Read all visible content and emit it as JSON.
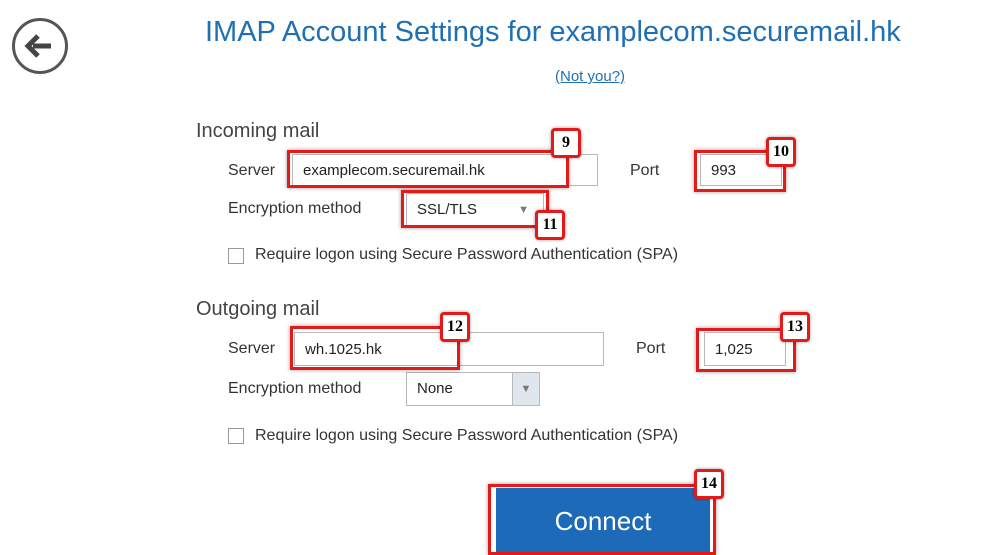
{
  "header": {
    "title": "IMAP Account Settings for examplecom.securemail.hk",
    "not_you": "(Not you?)"
  },
  "incoming": {
    "section_label": "Incoming mail",
    "server_label": "Server",
    "server_value": "examplecom.securemail.hk",
    "port_label": "Port",
    "port_value": "993",
    "encryption_label": "Encryption method",
    "encryption_value": "SSL/TLS",
    "spa_label": "Require logon using Secure Password Authentication (SPA)",
    "spa_checked": false
  },
  "outgoing": {
    "section_label": "Outgoing mail",
    "server_label": "Server",
    "server_value": "wh.1025.hk",
    "port_label": "Port",
    "port_value": "1,025",
    "encryption_label": "Encryption method",
    "encryption_value": "None",
    "spa_label": "Require logon using Secure Password Authentication (SPA)",
    "spa_checked": false
  },
  "connect_label": "Connect",
  "annotations": [
    "9",
    "10",
    "11",
    "12",
    "13",
    "14"
  ],
  "colors": {
    "accent": "#1f6fb4",
    "button": "#1d6ab8",
    "highlight": "#e21a1a"
  },
  "icons": {
    "back": "back-arrow-icon",
    "dropdown": "chevron-down-icon"
  }
}
